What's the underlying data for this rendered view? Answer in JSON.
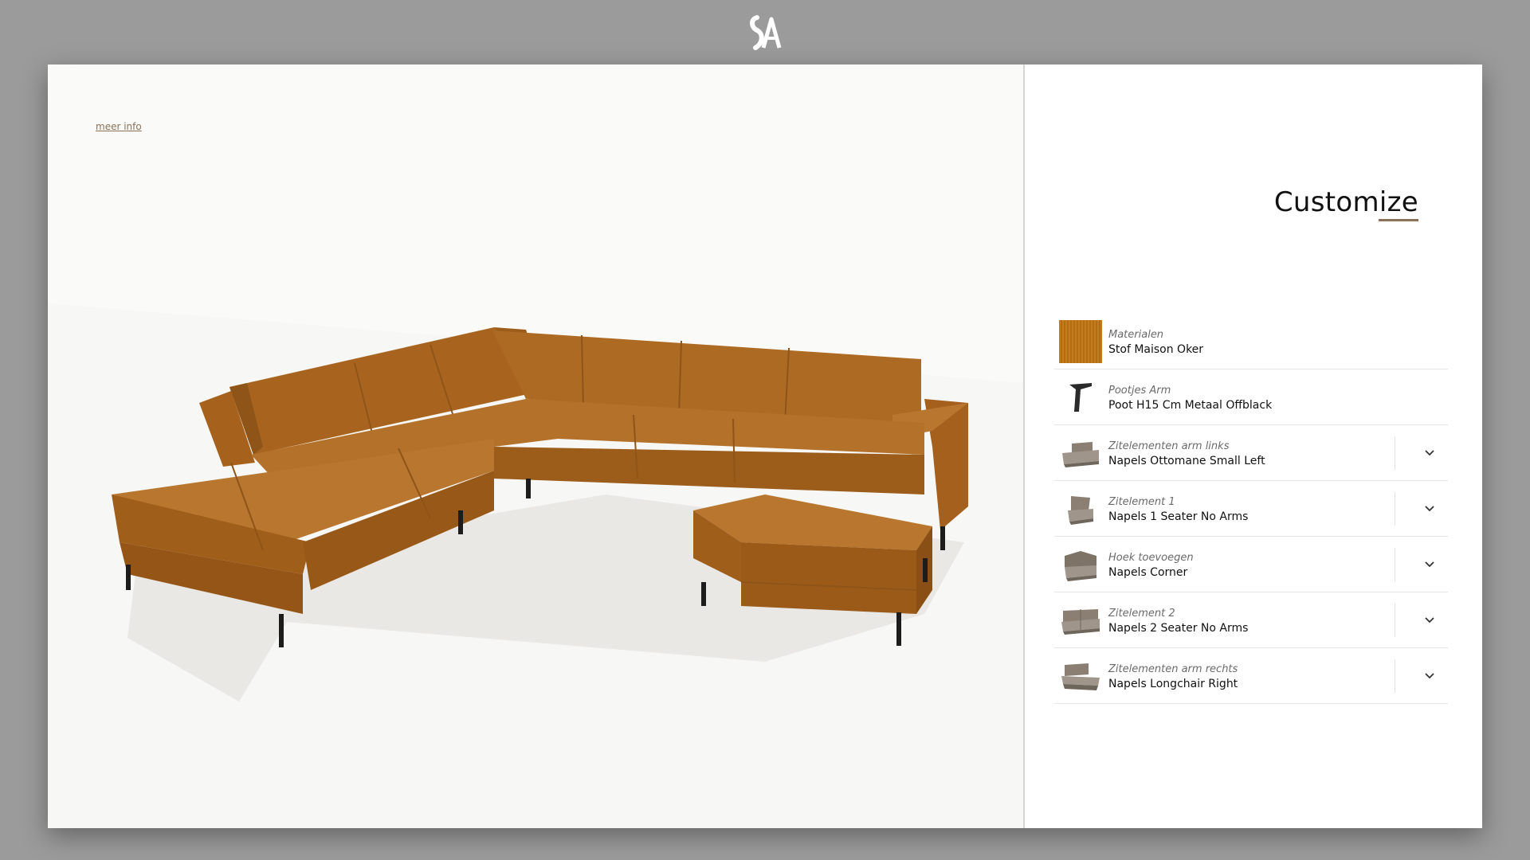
{
  "brand": {
    "logo_text": "SA"
  },
  "viewer": {
    "meer_info_label": "meer info"
  },
  "panel": {
    "title": "Customize",
    "options": [
      {
        "category": "Materialen",
        "value": "Stof Maison Oker",
        "icon": "fabric-swatch",
        "expandable": false
      },
      {
        "category": "Pootjes Arm",
        "value": "Poot H15 Cm Metaal Offblack",
        "icon": "leg-icon",
        "expandable": false
      },
      {
        "category": "Zitelementen arm links",
        "value": "Napels Ottomane Small Left",
        "icon": "ottoman-left-icon",
        "expandable": true
      },
      {
        "category": "Zitelement 1",
        "value": "Napels 1 Seater No Arms",
        "icon": "one-seater-icon",
        "expandable": true
      },
      {
        "category": "Hoek toevoegen",
        "value": "Napels Corner",
        "icon": "corner-icon",
        "expandable": true
      },
      {
        "category": "Zitelement 2",
        "value": "Napels 2 Seater No Arms",
        "icon": "two-seater-icon",
        "expandable": true
      },
      {
        "category": "Zitelementen arm rechts",
        "value": "Napels Longchair Right",
        "icon": "longchair-right-icon",
        "expandable": true
      }
    ]
  },
  "colors": {
    "background": "#9b9b9b",
    "accent": "#8a7157",
    "sofa_fabric": "#b4712a",
    "sofa_shadow": "#8e5418",
    "legs": "#1c1c1c",
    "module_thumb": "#9a8f82"
  }
}
